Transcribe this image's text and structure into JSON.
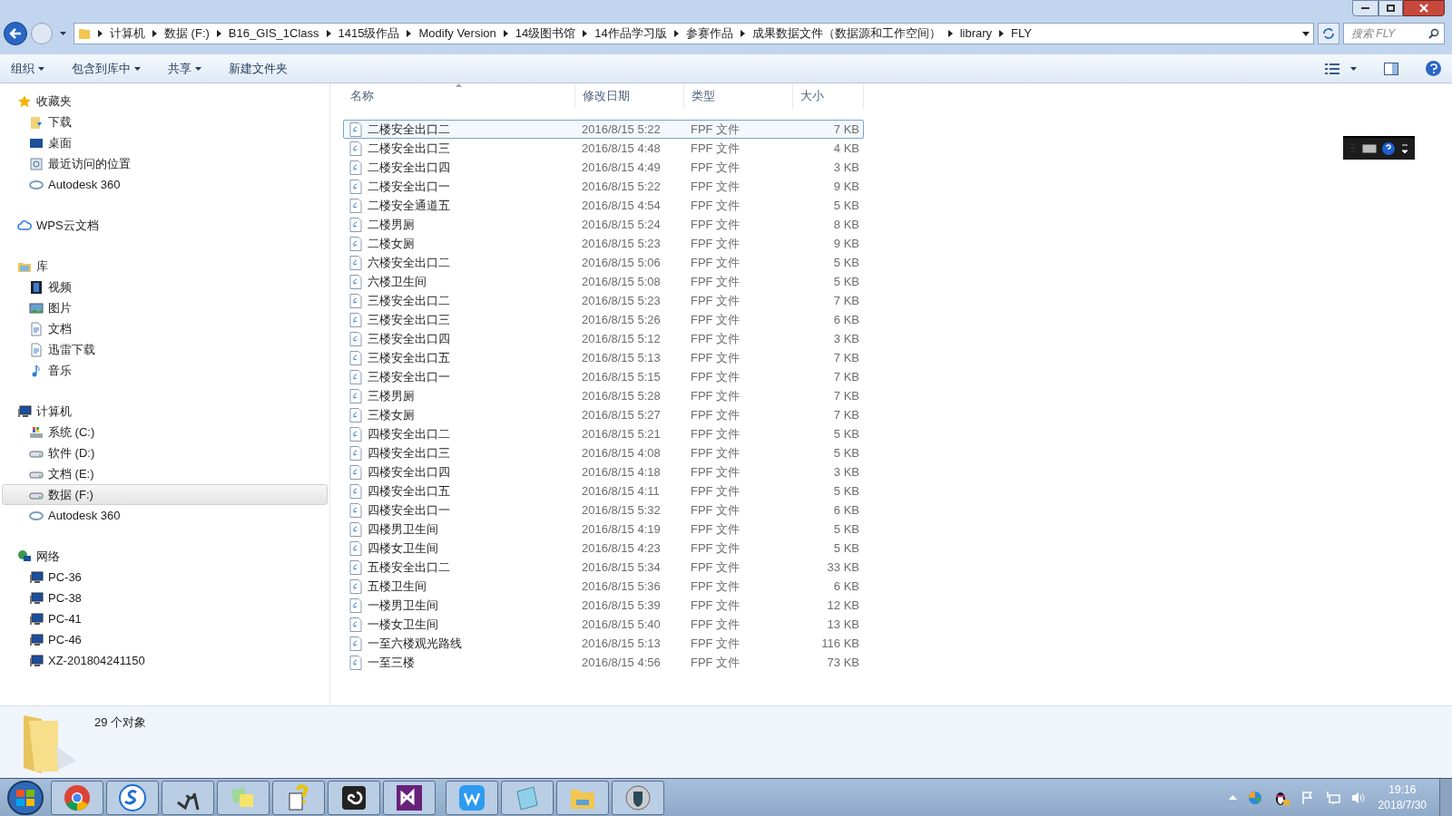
{
  "address": {
    "crumbs": [
      "计算机",
      "数据 (F:)",
      "B16_GIS_1Class",
      "1415级作品",
      "Modify Version",
      "14级图书馆",
      "14作品学习版",
      "参赛作品",
      "成果数据文件（数据源和工作空间）",
      "library",
      "FLY"
    ]
  },
  "search": {
    "placeholder": "搜索 FLY"
  },
  "toolbar": {
    "buttons": [
      {
        "label": "组织",
        "dropdown": true
      },
      {
        "label": "包含到库中",
        "dropdown": true
      },
      {
        "label": "共享",
        "dropdown": true
      },
      {
        "label": "新建文件夹",
        "dropdown": false
      }
    ]
  },
  "sidebar": {
    "groups": [
      {
        "label": "收藏夹",
        "kind": "star",
        "items": [
          {
            "label": "下载",
            "kind": "download",
            "selected": false
          },
          {
            "label": "桌面",
            "kind": "desktop",
            "selected": false
          },
          {
            "label": "最近访问的位置",
            "kind": "recent",
            "selected": false
          },
          {
            "label": "Autodesk 360",
            "kind": "cloud360",
            "selected": false
          }
        ]
      },
      {
        "label": "WPS云文档",
        "kind": "cloud"
      },
      {
        "label": "库",
        "kind": "library",
        "items": [
          {
            "label": "视频",
            "kind": "video",
            "selected": false
          },
          {
            "label": "图片",
            "kind": "picture",
            "selected": false
          },
          {
            "label": "文档",
            "kind": "document",
            "selected": false
          },
          {
            "label": "迅雷下载",
            "kind": "document",
            "selected": false
          },
          {
            "label": "音乐",
            "kind": "music",
            "selected": false
          }
        ]
      },
      {
        "label": "计算机",
        "kind": "computer",
        "items": [
          {
            "label": "系统 (C:)",
            "kind": "sysdrive",
            "selected": false
          },
          {
            "label": "软件 (D:)",
            "kind": "drive",
            "selected": false
          },
          {
            "label": "文档 (E:)",
            "kind": "drive",
            "selected": false
          },
          {
            "label": "数据 (F:)",
            "kind": "drive",
            "selected": true
          },
          {
            "label": "Autodesk 360",
            "kind": "cloud360",
            "selected": false
          }
        ]
      },
      {
        "label": "网络",
        "kind": "network",
        "items": [
          {
            "label": "PC-36",
            "kind": "computer",
            "selected": false
          },
          {
            "label": "PC-38",
            "kind": "computer",
            "selected": false
          },
          {
            "label": "PC-41",
            "kind": "computer",
            "selected": false
          },
          {
            "label": "PC-46",
            "kind": "computer",
            "selected": false
          },
          {
            "label": "XZ-201804241150",
            "kind": "computer",
            "selected": false
          }
        ]
      }
    ]
  },
  "table": {
    "columns": [
      "名称",
      "修改日期",
      "类型",
      "大小"
    ],
    "rows": [
      {
        "name": "二楼安全出口二",
        "date": "2016/8/15 5:22",
        "type": "FPF 文件",
        "size": "7 KB",
        "selected": true
      },
      {
        "name": "二楼安全出口三",
        "date": "2016/8/15 4:48",
        "type": "FPF 文件",
        "size": "4 KB",
        "selected": false
      },
      {
        "name": "二楼安全出口四",
        "date": "2016/8/15 4:49",
        "type": "FPF 文件",
        "size": "3 KB",
        "selected": false
      },
      {
        "name": "二楼安全出口一",
        "date": "2016/8/15 5:22",
        "type": "FPF 文件",
        "size": "9 KB",
        "selected": false
      },
      {
        "name": "二楼安全通道五",
        "date": "2016/8/15 4:54",
        "type": "FPF 文件",
        "size": "5 KB",
        "selected": false
      },
      {
        "name": "二楼男厕",
        "date": "2016/8/15 5:24",
        "type": "FPF 文件",
        "size": "8 KB",
        "selected": false
      },
      {
        "name": "二楼女厕",
        "date": "2016/8/15 5:23",
        "type": "FPF 文件",
        "size": "9 KB",
        "selected": false
      },
      {
        "name": "六楼安全出口二",
        "date": "2016/8/15 5:06",
        "type": "FPF 文件",
        "size": "5 KB",
        "selected": false
      },
      {
        "name": "六楼卫生间",
        "date": "2016/8/15 5:08",
        "type": "FPF 文件",
        "size": "5 KB",
        "selected": false
      },
      {
        "name": "三楼安全出口二",
        "date": "2016/8/15 5:23",
        "type": "FPF 文件",
        "size": "7 KB",
        "selected": false
      },
      {
        "name": "三楼安全出口三",
        "date": "2016/8/15 5:26",
        "type": "FPF 文件",
        "size": "6 KB",
        "selected": false
      },
      {
        "name": "三楼安全出口四",
        "date": "2016/8/15 5:12",
        "type": "FPF 文件",
        "size": "3 KB",
        "selected": false
      },
      {
        "name": "三楼安全出口五",
        "date": "2016/8/15 5:13",
        "type": "FPF 文件",
        "size": "7 KB",
        "selected": false
      },
      {
        "name": "三楼安全出口一",
        "date": "2016/8/15 5:15",
        "type": "FPF 文件",
        "size": "7 KB",
        "selected": false
      },
      {
        "name": "三楼男厕",
        "date": "2016/8/15 5:28",
        "type": "FPF 文件",
        "size": "7 KB",
        "selected": false
      },
      {
        "name": "三楼女厕",
        "date": "2016/8/15 5:27",
        "type": "FPF 文件",
        "size": "7 KB",
        "selected": false
      },
      {
        "name": "四楼安全出口二",
        "date": "2016/8/15 5:21",
        "type": "FPF 文件",
        "size": "5 KB",
        "selected": false
      },
      {
        "name": "四楼安全出口三",
        "date": "2016/8/15 4:08",
        "type": "FPF 文件",
        "size": "5 KB",
        "selected": false
      },
      {
        "name": "四楼安全出口四",
        "date": "2016/8/15 4:18",
        "type": "FPF 文件",
        "size": "3 KB",
        "selected": false
      },
      {
        "name": "四楼安全出口五",
        "date": "2016/8/15 4:11",
        "type": "FPF 文件",
        "size": "5 KB",
        "selected": false
      },
      {
        "name": "四楼安全出口一",
        "date": "2016/8/15 5:32",
        "type": "FPF 文件",
        "size": "6 KB",
        "selected": false
      },
      {
        "name": "四楼男卫生间",
        "date": "2016/8/15 4:19",
        "type": "FPF 文件",
        "size": "5 KB",
        "selected": false
      },
      {
        "name": "四楼女卫生间",
        "date": "2016/8/15 4:23",
        "type": "FPF 文件",
        "size": "5 KB",
        "selected": false
      },
      {
        "name": "五楼安全出口二",
        "date": "2016/8/15 5:34",
        "type": "FPF 文件",
        "size": "33 KB",
        "selected": false
      },
      {
        "name": "五楼卫生间",
        "date": "2016/8/15 5:36",
        "type": "FPF 文件",
        "size": "6 KB",
        "selected": false
      },
      {
        "name": "一楼男卫生间",
        "date": "2016/8/15 5:39",
        "type": "FPF 文件",
        "size": "12 KB",
        "selected": false
      },
      {
        "name": "一楼女卫生间",
        "date": "2016/8/15 5:40",
        "type": "FPF 文件",
        "size": "13 KB",
        "selected": false
      },
      {
        "name": "一至六楼观光路线",
        "date": "2016/8/15 5:13",
        "type": "FPF 文件",
        "size": "116 KB",
        "selected": false
      },
      {
        "name": "一至三楼",
        "date": "2016/8/15 4:56",
        "type": "FPF 文件",
        "size": "73 KB",
        "selected": false
      }
    ]
  },
  "details": {
    "text": "29 个对象"
  },
  "taskbar": {
    "apps": [
      {
        "kind": "chrome"
      },
      {
        "kind": "s"
      },
      {
        "kind": "pen"
      },
      {
        "kind": "notes"
      },
      {
        "kind": "help"
      },
      {
        "kind": "spiral"
      },
      {
        "kind": "vs"
      },
      {
        "kind": "w"
      },
      {
        "kind": "notepad"
      },
      {
        "kind": "folder"
      },
      {
        "kind": "shield"
      }
    ],
    "time": "19:16",
    "date": "2018/7/30"
  }
}
